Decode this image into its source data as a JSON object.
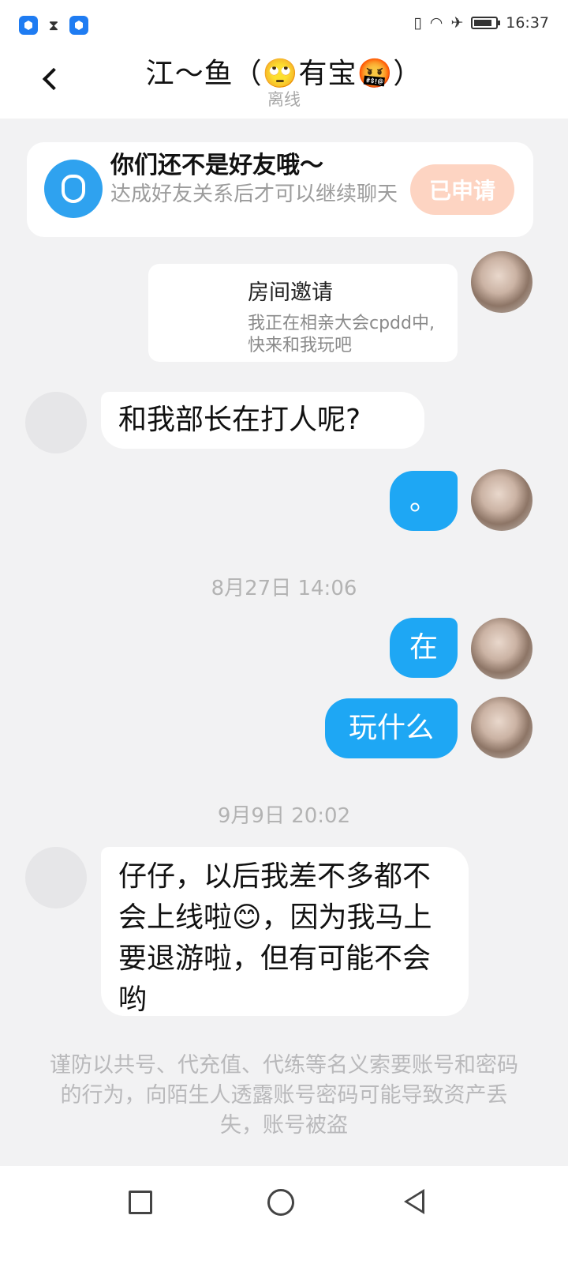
{
  "status_bar": {
    "time": "16:37",
    "icons": [
      "app-icon",
      "hourglass-icon",
      "app-icon",
      "vibrate-icon",
      "wifi-icon",
      "airplane-icon",
      "battery-icon"
    ]
  },
  "header": {
    "title": "江～鱼（🙄有宝🤬）",
    "subtitle": "离线"
  },
  "friend_card": {
    "title": "你们还不是好友哦～",
    "description": "达成好友关系后才可以继续聊天",
    "button_label": "已申请"
  },
  "messages": [
    {
      "side": "out",
      "type": "invite",
      "title": "房间邀请",
      "desc": "我正在相亲大会cpdd中, 快来和我玩吧"
    },
    {
      "side": "in",
      "type": "text",
      "text": "和我部长在打人呢?"
    },
    {
      "side": "out",
      "type": "text",
      "text": "。"
    },
    {
      "type": "timestamp",
      "text": "8月27日 14:06"
    },
    {
      "side": "out",
      "type": "text",
      "text": "在"
    },
    {
      "side": "out",
      "type": "text",
      "text": "玩什么"
    },
    {
      "type": "timestamp",
      "text": "9月9日 20:02"
    },
    {
      "side": "in",
      "type": "text",
      "text": "仔仔，以后我差不多都不会上线啦😊，因为我马上要退游啦，但有可能不会哟"
    }
  ],
  "warning": "谨防以共号、代充值、代练等名义索要账号和密码的行为，向陌生人透露账号密码可能导致资产丢失，账号被盗",
  "nav": [
    "recent-apps-icon",
    "home-icon",
    "back-icon"
  ]
}
